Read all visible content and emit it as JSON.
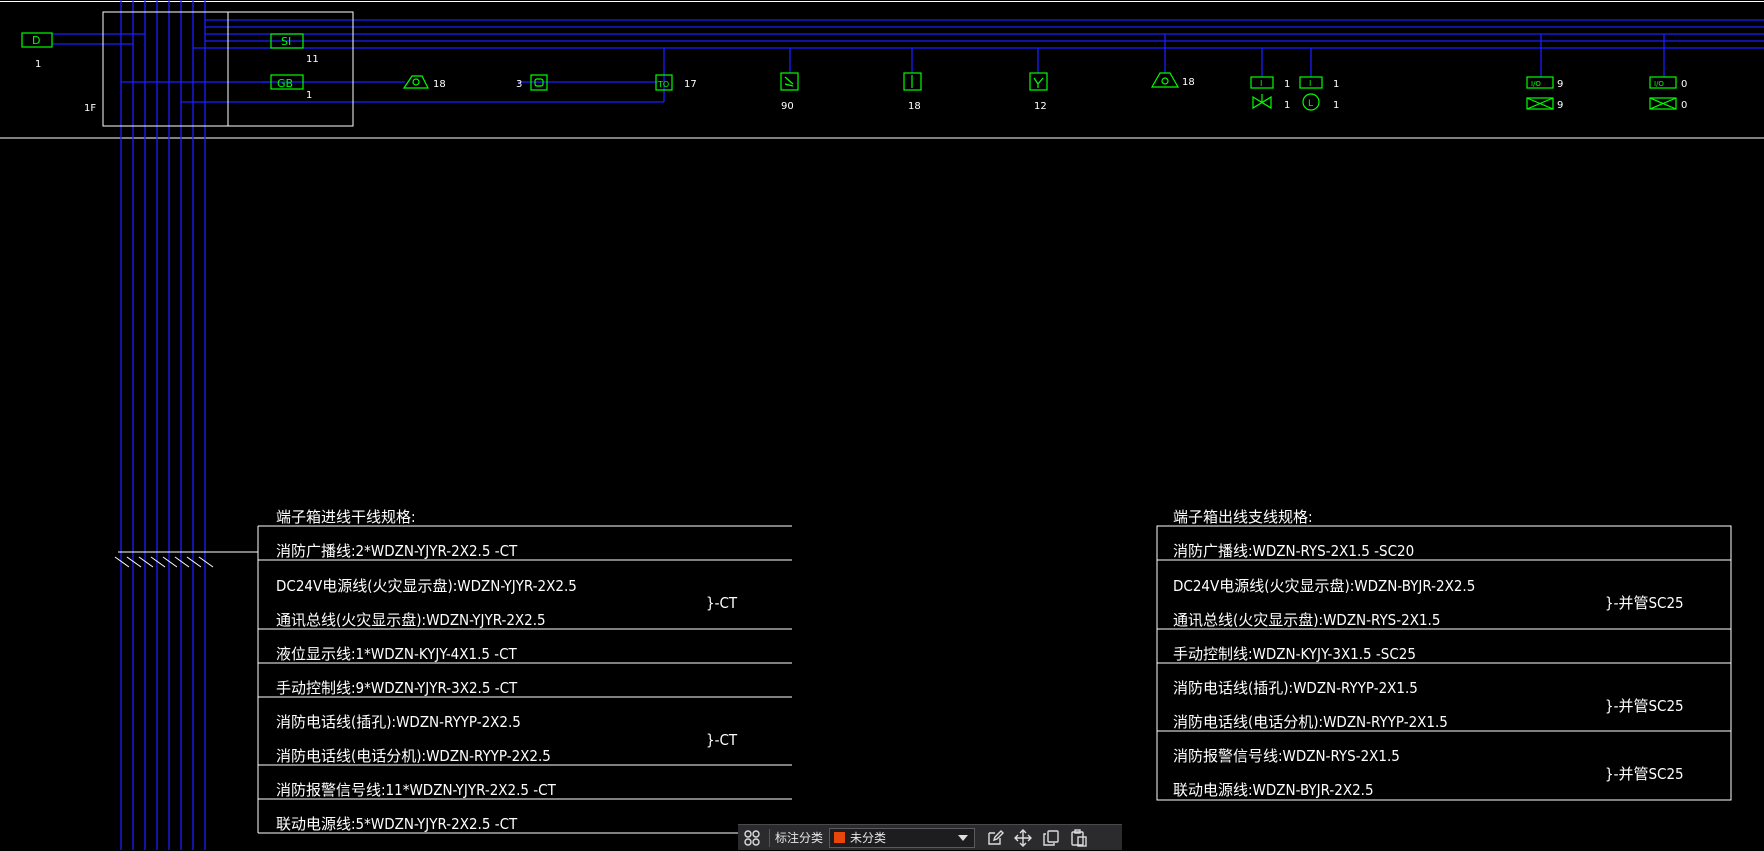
{
  "colors": {
    "background": "#000000",
    "bus_line": "#1c1cff",
    "symbol": "#00ff00",
    "text": "#ffffff",
    "toolbar_bg": "#2b2b2e",
    "swatch": "#e8470b"
  },
  "riser": {
    "floor_label": "1F",
    "module_d": {
      "label": "D",
      "count": "1"
    },
    "module_si": {
      "label": "SI",
      "count": "11"
    },
    "module_gb": {
      "label": "GB",
      "count": "1"
    },
    "devices": [
      {
        "icon": "broadcast-speaker-icon",
        "count": "18"
      },
      {
        "icon": "fire-telephone-icon",
        "count": "3"
      },
      {
        "icon": "telephone-jack-icon",
        "label": "TO",
        "count": "17"
      },
      {
        "icon": "smoke-detector-icon",
        "count": "90"
      },
      {
        "icon": "manual-alarm-button-icon",
        "count": "18"
      },
      {
        "icon": "hydrant-button-icon",
        "count": "12"
      },
      {
        "icon": "sound-light-alarm-icon",
        "count": "18"
      },
      {
        "icon": "input-module-icon",
        "label": "I",
        "count": "1"
      },
      {
        "icon": "signal-valve-icon",
        "count": "1"
      },
      {
        "icon": "input-module-icon",
        "label": "I",
        "count": "1"
      },
      {
        "icon": "flow-indicator-icon",
        "label": "L",
        "count": "1"
      },
      {
        "icon": "io-module-icon",
        "label": "I/O",
        "count": "9"
      },
      {
        "icon": "damper-icon",
        "count": "9"
      },
      {
        "icon": "io-module-icon",
        "label": "I/O",
        "count": "0"
      },
      {
        "icon": "damper-icon",
        "count": "0"
      }
    ]
  },
  "spec_in": {
    "title": "端子箱进线干线规格:",
    "rows": [
      [
        "消防广播线:2*WDZN-YJYR-2X2.5  -CT"
      ],
      [
        "DC24V电源线(火灾显示盘):WDZN-YJYR-2X2.5",
        "通讯总线(火灾显示盘):WDZN-YJYR-2X2.5"
      ],
      [
        "液位显示线:1*WDZN-KYJY-4X1.5  -CT"
      ],
      [
        "手动控制线:9*WDZN-YJYR-3X2.5  -CT"
      ],
      [
        "消防电话线(插孔):WDZN-RYYP-2X2.5",
        "消防电话线(电话分机):WDZN-RYYP-2X2.5"
      ],
      [
        "消防报警信号线:11*WDZN-YJYR-2X2.5  -CT"
      ],
      [
        "联动电源线:5*WDZN-YJYR-2X2.5  -CT"
      ]
    ],
    "braces": [
      "}-CT",
      "}-CT"
    ]
  },
  "spec_out": {
    "title": "端子箱出线支线规格:",
    "rows": [
      [
        "消防广播线:WDZN-RYS-2X1.5  -SC20"
      ],
      [
        "DC24V电源线(火灾显示盘):WDZN-BYJR-2X2.5",
        "通讯总线(火灾显示盘):WDZN-RYS-2X1.5"
      ],
      [
        "手动控制线:WDZN-KYJY-3X1.5  -SC25"
      ],
      [
        "消防电话线(插孔):WDZN-RYYP-2X1.5",
        "消防电话线(电话分机):WDZN-RYYP-2X1.5"
      ],
      [
        "消防报警信号线:WDZN-RYS-2X1.5",
        "联动电源线:WDZN-BYJR-2X2.5"
      ]
    ],
    "braces": [
      "}-并管SC25",
      "}-并管SC25",
      "}-并管SC25"
    ]
  },
  "toolbar": {
    "label": "标注分类",
    "selected": "未分类",
    "icons": [
      "grid-icon",
      "edit-icon",
      "move-icon",
      "copy-icon",
      "paste-icon"
    ]
  }
}
